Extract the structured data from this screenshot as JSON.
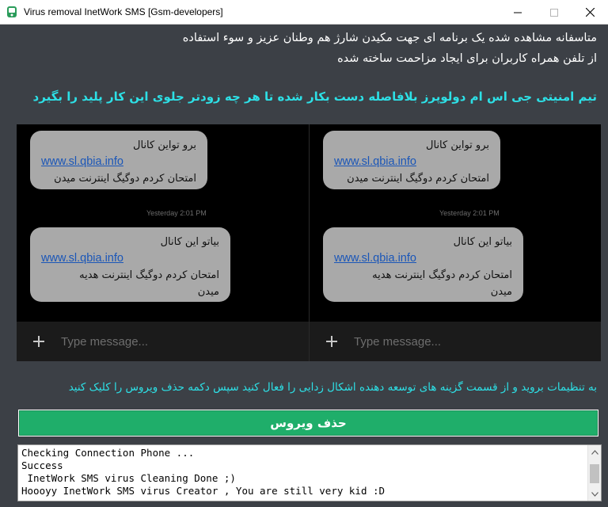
{
  "window": {
    "title": "Virus removal InetWork SMS [Gsm-developers]"
  },
  "header": {
    "line1": "متاسفانه مشاهده شده یک برنامه ای جهت مکیدن شارژ هم وطنان عزیز و سوء استفاده",
    "line2": "از تلفن همراه کاربران برای ایجاد مزاحمت ساخته شده",
    "highlight": "تیم امنیتی جی اس ام دولوپرز بلافاصله دست بکار شده تا هر چه زودتر جلوی این کار پلید را بگیرد"
  },
  "screenshots": {
    "bubble1": {
      "line1": "برو تواین کانال",
      "link": "www.sl.qbia.info",
      "line2": "امتحان کردم دوگیگ اینترنت میدن"
    },
    "timestamp": "Yesterday 2:01 PM",
    "bubble2": {
      "line1": "بیاتو این کانال",
      "link": "www.sl.qbia.info",
      "line2": "امتحان کردم دوگیگ اینترنت هدیه",
      "line3": "میدن"
    },
    "compose_placeholder": "Type message..."
  },
  "instruction": "به تنظیمات بروید و از قسمت گزینه های توسعه دهنده اشکال زدایی را فعال کنید سپس دکمه حذف ویروس را کلیک کنید",
  "action_button": "حذف ویروس",
  "log": {
    "lines": [
      "Checking Connection Phone ...",
      "Success",
      " InetWork SMS virus Cleaning Done ;)",
      "Hoooyy InetWork SMS virus Creator , You are still very kid :D"
    ]
  },
  "colors": {
    "background": "#3c4046",
    "highlight": "#2de0e6",
    "button": "#1fae6a",
    "bubble": "#a9a9a9"
  },
  "icons": [
    "app-icon",
    "minimize-icon",
    "maximize-icon",
    "close-icon",
    "plus-icon",
    "send-icon",
    "scroll-up-icon",
    "scroll-down-icon"
  ]
}
